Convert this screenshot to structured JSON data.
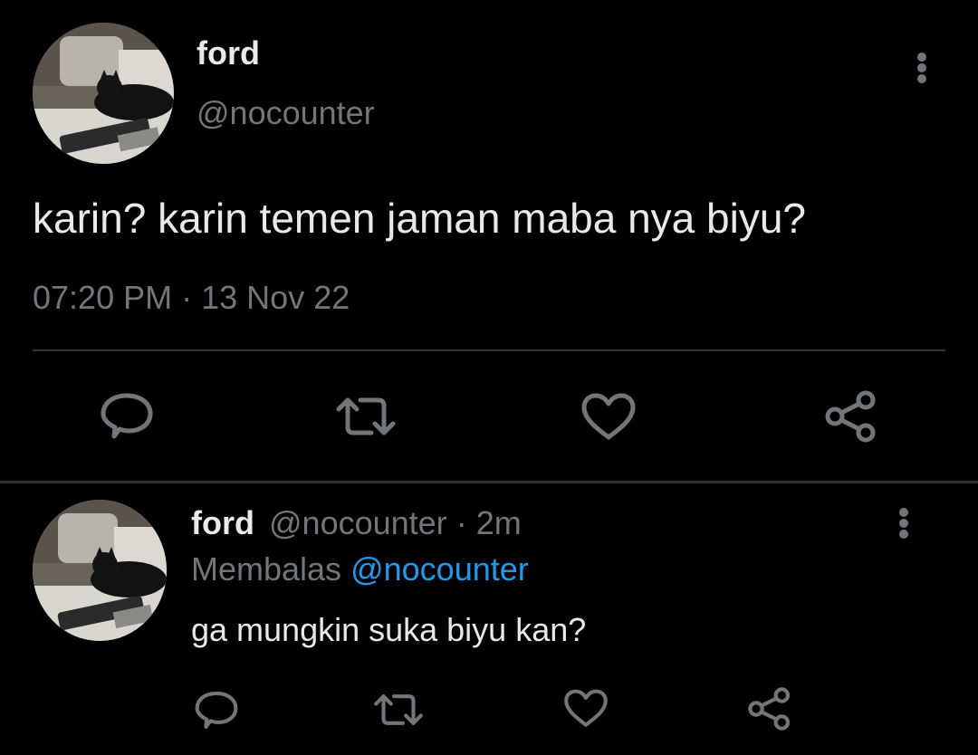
{
  "main_tweet": {
    "display_name": "ford",
    "handle": "@nocounter",
    "text": "karin? karin temen jaman maba nya biyu?",
    "time": "07:20 PM",
    "separator": "·",
    "date": "13 Nov 22"
  },
  "reply_tweet": {
    "display_name": "ford",
    "handle": "@nocounter",
    "separator": "·",
    "age": "2m",
    "replying_label": "Membalas",
    "replying_to": "@nocounter",
    "text": "ga mungkin suka biyu kan?"
  },
  "icons": {
    "reply": "comment-bubble-icon",
    "retweet": "retweet-arrows-icon",
    "like": "heart-outline-icon",
    "share": "share-nodes-icon",
    "more": "vertical-ellipsis-icon"
  },
  "colors": {
    "background": "#000000",
    "text": "#e7e9ea",
    "muted": "#71767b",
    "link": "#1d9bf0",
    "divider": "#2f3336"
  }
}
